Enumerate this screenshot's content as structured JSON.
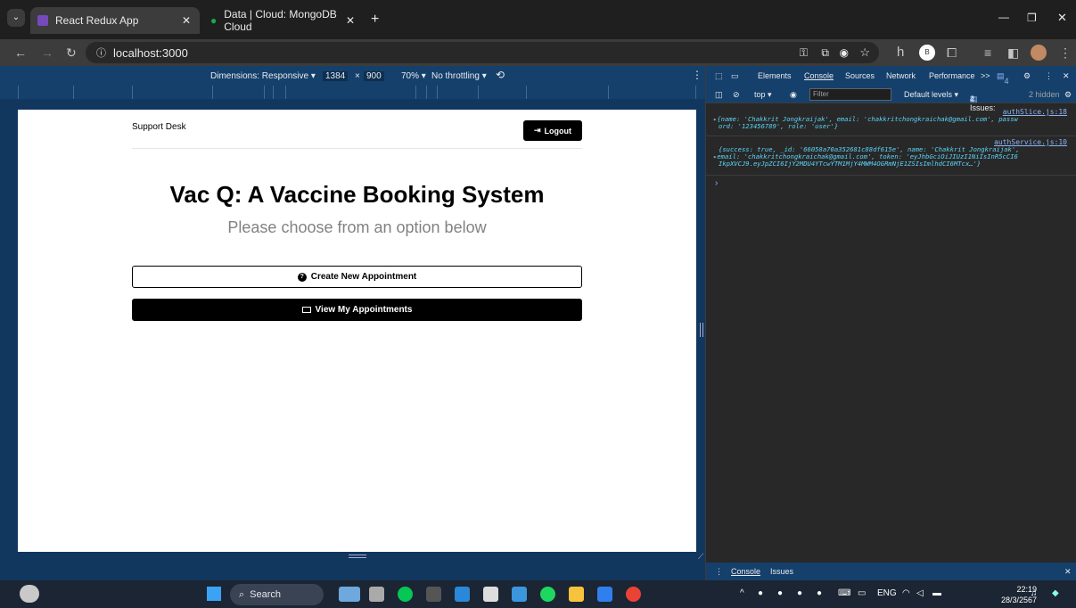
{
  "browser": {
    "tabs": [
      {
        "label": "React Redux App",
        "active": true
      },
      {
        "label": "Data | Cloud: MongoDB Cloud",
        "active": false
      }
    ],
    "address": "localhost:3000",
    "profile_letter": "h",
    "profile_badge": "B"
  },
  "device_toolbar": {
    "dimensions": "Dimensions: Responsive ▾",
    "width": "1384",
    "times": "×",
    "height": "900",
    "zoom": "70% ▾",
    "throttling": "No throttling ▾"
  },
  "page": {
    "logo": "Support Desk",
    "logout_label": "Logout",
    "heading": "Vac Q: A Vaccine Booking System",
    "subheading": "Please choose from an option below",
    "create_label": "Create New Appointment",
    "view_label": "View My Appointments"
  },
  "devtools": {
    "tabs": [
      "Elements",
      "Console",
      "Sources",
      "Network",
      "Performance"
    ],
    "active_tab": "Console",
    "more": ">>",
    "issues_badge": "4",
    "context": "top ▾",
    "filter_placeholder": "Filter",
    "levels": "Default levels ▾",
    "issues": "2 Issues:",
    "issues_count": "4",
    "hidden": "2 hidden",
    "log1_source": "authSlice.js:18",
    "log1_line1": "{name: 'Chakkrit Jongkraijak', email: 'chakkritchongkraichak@gmail.com', passw",
    "log1_line2": "ord: '123456789', role: 'user'}",
    "log2_source": "authService.js:10",
    "log2_line1": "{success: true, _id: '66058a70a352681c88df615e', name: 'Chakkrit Jongkraijak',",
    "log2_line2": "email: 'chakkritchongkraichak@gmail.com', token: 'eyJhbGciOiJIUzI1NiIsInR5cCI6",
    "log2_line3": "IkpXVCJ9.eyJpZCI6IjY2MDU4YTcwYTM1MjY4MWM4OGRmNjE1ZSIsImlhdCI6MTcx…'}",
    "drawer_tabs": [
      "Console",
      "Issues"
    ]
  },
  "taskbar": {
    "search": "Search",
    "lang": "ENG",
    "time": "22:19",
    "date": "28/3/2567"
  },
  "colors": {
    "devbar": "#15406b",
    "viewport_bg": "#11375f",
    "taskbar": "#1c2533",
    "button_black": "#000000"
  }
}
